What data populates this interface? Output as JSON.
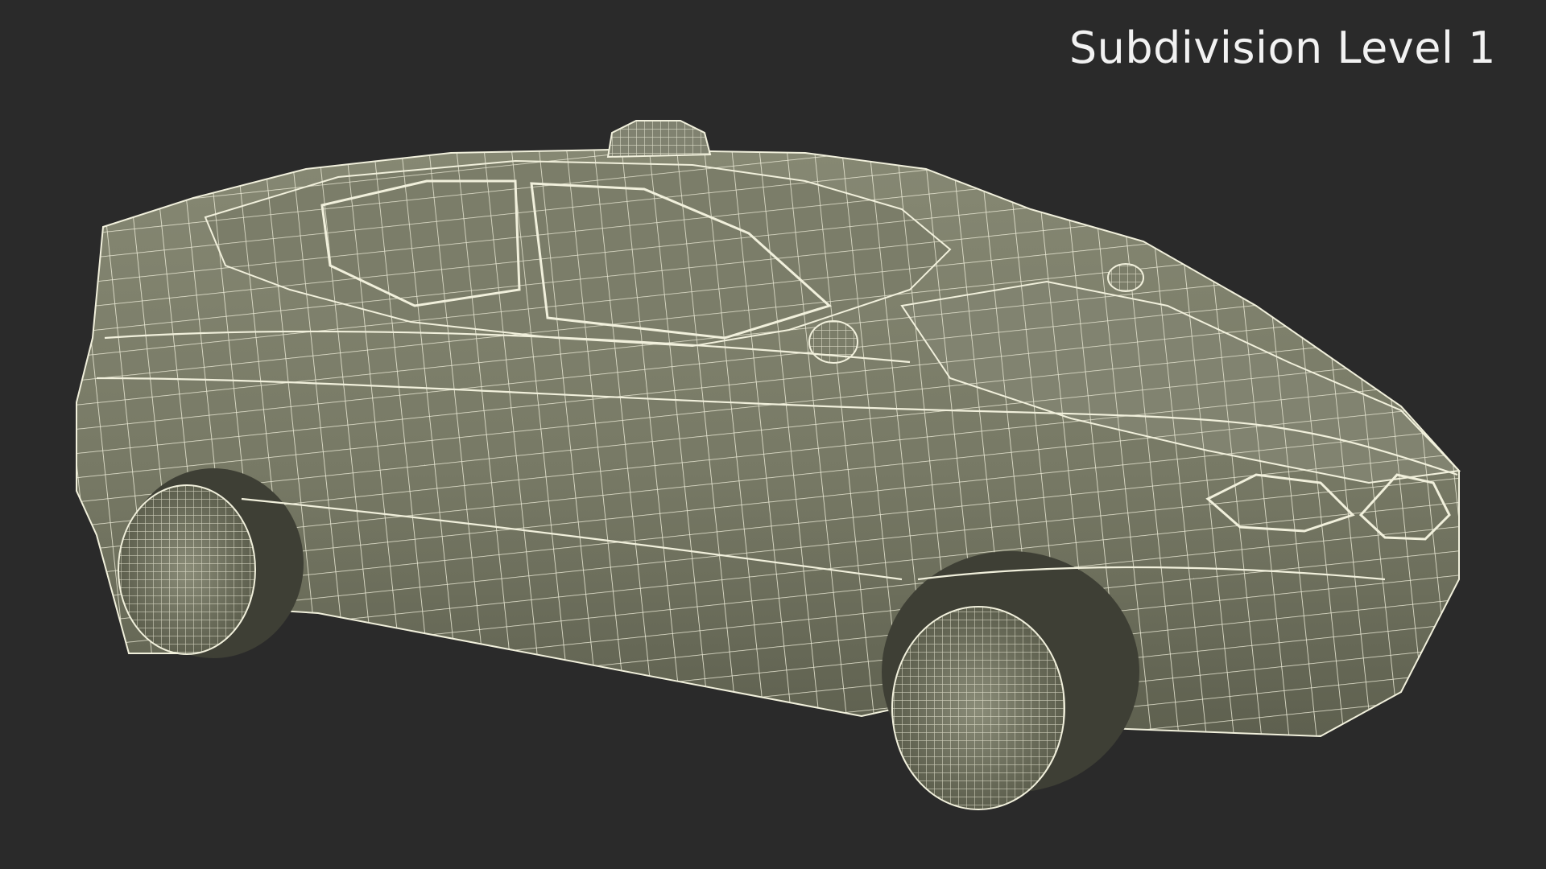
{
  "overlay": {
    "subdivision_label": "Subdivision Level 1"
  },
  "render": {
    "background_color": "#2a2a2a",
    "mesh_fill_color": "#7a7c69",
    "mesh_shadow_color": "#5f614f",
    "wire_color": "#f1f0dc",
    "object": "car-wireframe"
  }
}
